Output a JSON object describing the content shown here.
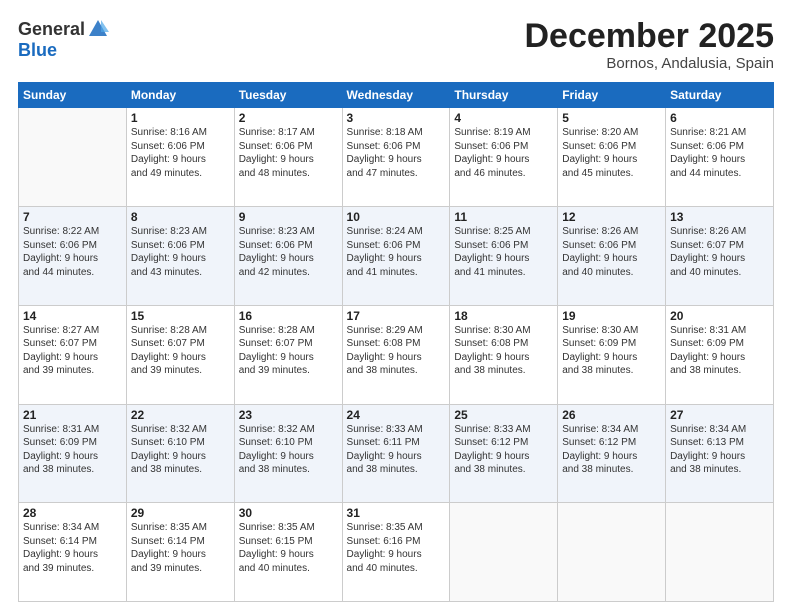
{
  "logo": {
    "general": "General",
    "blue": "Blue"
  },
  "header": {
    "month": "December 2025",
    "location": "Bornos, Andalusia, Spain"
  },
  "weekdays": [
    "Sunday",
    "Monday",
    "Tuesday",
    "Wednesday",
    "Thursday",
    "Friday",
    "Saturday"
  ],
  "weeks": [
    [
      {
        "day": "",
        "info": ""
      },
      {
        "day": "1",
        "info": "Sunrise: 8:16 AM\nSunset: 6:06 PM\nDaylight: 9 hours\nand 49 minutes."
      },
      {
        "day": "2",
        "info": "Sunrise: 8:17 AM\nSunset: 6:06 PM\nDaylight: 9 hours\nand 48 minutes."
      },
      {
        "day": "3",
        "info": "Sunrise: 8:18 AM\nSunset: 6:06 PM\nDaylight: 9 hours\nand 47 minutes."
      },
      {
        "day": "4",
        "info": "Sunrise: 8:19 AM\nSunset: 6:06 PM\nDaylight: 9 hours\nand 46 minutes."
      },
      {
        "day": "5",
        "info": "Sunrise: 8:20 AM\nSunset: 6:06 PM\nDaylight: 9 hours\nand 45 minutes."
      },
      {
        "day": "6",
        "info": "Sunrise: 8:21 AM\nSunset: 6:06 PM\nDaylight: 9 hours\nand 44 minutes."
      }
    ],
    [
      {
        "day": "7",
        "info": "Sunrise: 8:22 AM\nSunset: 6:06 PM\nDaylight: 9 hours\nand 44 minutes."
      },
      {
        "day": "8",
        "info": "Sunrise: 8:23 AM\nSunset: 6:06 PM\nDaylight: 9 hours\nand 43 minutes."
      },
      {
        "day": "9",
        "info": "Sunrise: 8:23 AM\nSunset: 6:06 PM\nDaylight: 9 hours\nand 42 minutes."
      },
      {
        "day": "10",
        "info": "Sunrise: 8:24 AM\nSunset: 6:06 PM\nDaylight: 9 hours\nand 41 minutes."
      },
      {
        "day": "11",
        "info": "Sunrise: 8:25 AM\nSunset: 6:06 PM\nDaylight: 9 hours\nand 41 minutes."
      },
      {
        "day": "12",
        "info": "Sunrise: 8:26 AM\nSunset: 6:06 PM\nDaylight: 9 hours\nand 40 minutes."
      },
      {
        "day": "13",
        "info": "Sunrise: 8:26 AM\nSunset: 6:07 PM\nDaylight: 9 hours\nand 40 minutes."
      }
    ],
    [
      {
        "day": "14",
        "info": "Sunrise: 8:27 AM\nSunset: 6:07 PM\nDaylight: 9 hours\nand 39 minutes."
      },
      {
        "day": "15",
        "info": "Sunrise: 8:28 AM\nSunset: 6:07 PM\nDaylight: 9 hours\nand 39 minutes."
      },
      {
        "day": "16",
        "info": "Sunrise: 8:28 AM\nSunset: 6:07 PM\nDaylight: 9 hours\nand 39 minutes."
      },
      {
        "day": "17",
        "info": "Sunrise: 8:29 AM\nSunset: 6:08 PM\nDaylight: 9 hours\nand 38 minutes."
      },
      {
        "day": "18",
        "info": "Sunrise: 8:30 AM\nSunset: 6:08 PM\nDaylight: 9 hours\nand 38 minutes."
      },
      {
        "day": "19",
        "info": "Sunrise: 8:30 AM\nSunset: 6:09 PM\nDaylight: 9 hours\nand 38 minutes."
      },
      {
        "day": "20",
        "info": "Sunrise: 8:31 AM\nSunset: 6:09 PM\nDaylight: 9 hours\nand 38 minutes."
      }
    ],
    [
      {
        "day": "21",
        "info": "Sunrise: 8:31 AM\nSunset: 6:09 PM\nDaylight: 9 hours\nand 38 minutes."
      },
      {
        "day": "22",
        "info": "Sunrise: 8:32 AM\nSunset: 6:10 PM\nDaylight: 9 hours\nand 38 minutes."
      },
      {
        "day": "23",
        "info": "Sunrise: 8:32 AM\nSunset: 6:10 PM\nDaylight: 9 hours\nand 38 minutes."
      },
      {
        "day": "24",
        "info": "Sunrise: 8:33 AM\nSunset: 6:11 PM\nDaylight: 9 hours\nand 38 minutes."
      },
      {
        "day": "25",
        "info": "Sunrise: 8:33 AM\nSunset: 6:12 PM\nDaylight: 9 hours\nand 38 minutes."
      },
      {
        "day": "26",
        "info": "Sunrise: 8:34 AM\nSunset: 6:12 PM\nDaylight: 9 hours\nand 38 minutes."
      },
      {
        "day": "27",
        "info": "Sunrise: 8:34 AM\nSunset: 6:13 PM\nDaylight: 9 hours\nand 38 minutes."
      }
    ],
    [
      {
        "day": "28",
        "info": "Sunrise: 8:34 AM\nSunset: 6:14 PM\nDaylight: 9 hours\nand 39 minutes."
      },
      {
        "day": "29",
        "info": "Sunrise: 8:35 AM\nSunset: 6:14 PM\nDaylight: 9 hours\nand 39 minutes."
      },
      {
        "day": "30",
        "info": "Sunrise: 8:35 AM\nSunset: 6:15 PM\nDaylight: 9 hours\nand 40 minutes."
      },
      {
        "day": "31",
        "info": "Sunrise: 8:35 AM\nSunset: 6:16 PM\nDaylight: 9 hours\nand 40 minutes."
      },
      {
        "day": "",
        "info": ""
      },
      {
        "day": "",
        "info": ""
      },
      {
        "day": "",
        "info": ""
      }
    ]
  ]
}
